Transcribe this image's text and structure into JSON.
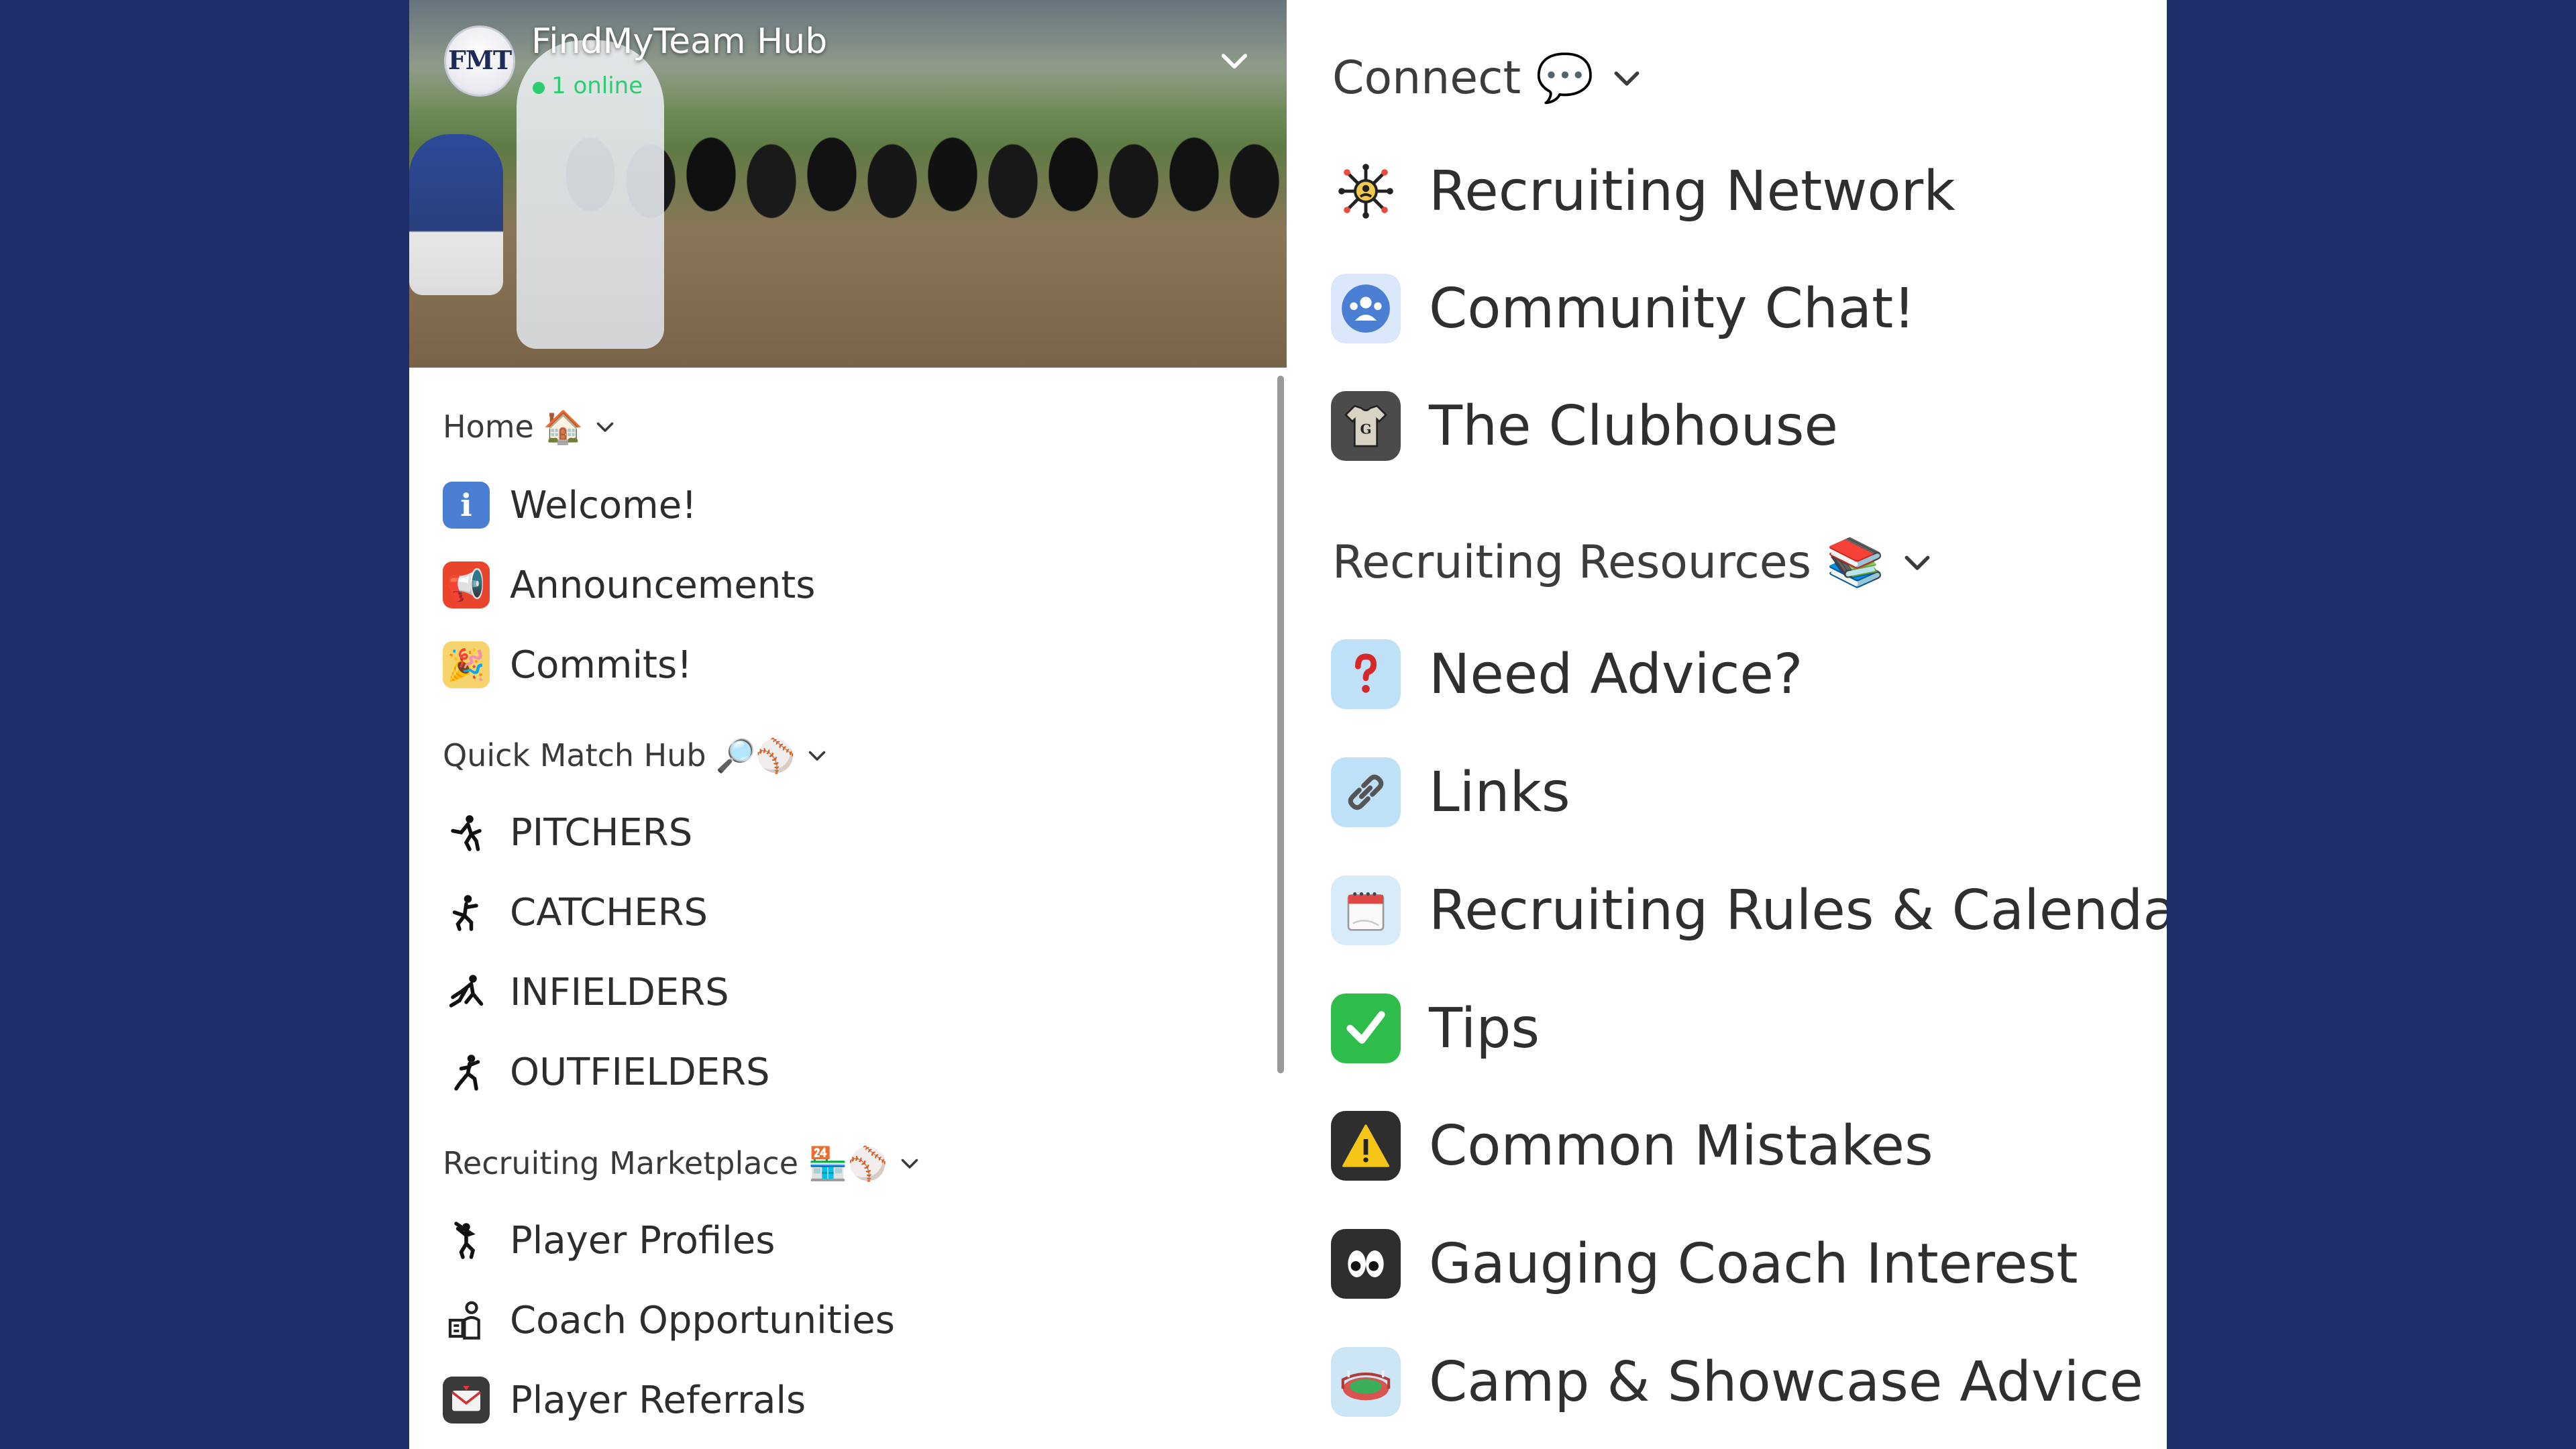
{
  "header": {
    "title": "FindMyTeam Hub",
    "logo_text": "FMT",
    "online_status": "1 online"
  },
  "left": {
    "sections": [
      {
        "label": "Home",
        "emoji": "🏠",
        "items": [
          {
            "label": "Welcome!",
            "icon": "info-icon",
            "glyph": "i",
            "color": "#4a7fd4"
          },
          {
            "label": "Announcements",
            "icon": "megaphone-icon",
            "glyph": "📢",
            "color": "#e8452c"
          },
          {
            "label": "Commits!",
            "icon": "party-popper-icon",
            "glyph": "🎉",
            "color": "#f6d36b"
          }
        ]
      },
      {
        "label": "Quick Match Hub",
        "emoji": "🔎⚾",
        "items": [
          {
            "label": "PITCHERS",
            "icon": "pitcher-icon",
            "glyph": "🤾"
          },
          {
            "label": "CATCHERS",
            "icon": "catcher-icon",
            "glyph": "🏃"
          },
          {
            "label": "INFIELDERS",
            "icon": "infielder-icon",
            "glyph": "🤸"
          },
          {
            "label": "OUTFIELDERS",
            "icon": "outfielder-icon",
            "glyph": "🏃"
          }
        ]
      },
      {
        "label": "Recruiting Marketplace",
        "emoji": "🏪⚾",
        "items": [
          {
            "label": "Player Profiles",
            "icon": "batter-icon",
            "glyph": "🏌"
          },
          {
            "label": "Coach Opportunities",
            "icon": "coach-icon",
            "glyph": "📋"
          },
          {
            "label": "Player Referrals",
            "icon": "envelope-icon",
            "glyph": "📩",
            "color": "#3a3a3a"
          }
        ]
      }
    ]
  },
  "right": {
    "sections": [
      {
        "label": "Connect",
        "emoji": "💬",
        "items": [
          {
            "label": "Recruiting Network",
            "icon": "network-icon",
            "glyph": "🕸"
          },
          {
            "label": "Community Chat!",
            "icon": "people-chat-icon",
            "glyph": "👥",
            "color": "#4a7fd4"
          },
          {
            "label": "The Clubhouse",
            "icon": "jersey-icon",
            "glyph": "👕",
            "color": "#4b4b4b"
          }
        ]
      },
      {
        "label": "Recruiting Resources",
        "emoji": "📚",
        "items": [
          {
            "label": "Need Advice?",
            "icon": "question-icon",
            "glyph": "❓",
            "color": "#bfe1f7"
          },
          {
            "label": "Links",
            "icon": "link-icon",
            "glyph": "🔗",
            "color": "#bfe1f7"
          },
          {
            "label": "Recruiting Rules & Calendar",
            "icon": "calendar-icon",
            "glyph": "🗓",
            "color": "#d7ecf8"
          },
          {
            "label": "Tips",
            "icon": "checkmark-icon",
            "glyph": "✅",
            "color": "#2ebd4a"
          },
          {
            "label": "Common Mistakes",
            "icon": "warning-icon",
            "glyph": "⚠",
            "color": "#2e2e2e"
          },
          {
            "label": "Gauging Coach Interest",
            "icon": "eyes-icon",
            "glyph": "👀",
            "color": "#2e2e2e"
          },
          {
            "label": "Camp & Showcase Advice",
            "icon": "stadium-icon",
            "glyph": "🏟",
            "color": "#cde6f6"
          }
        ]
      }
    ]
  },
  "colors": {
    "background": "#1f2d6b",
    "panel": "#ffffff",
    "online": "#2ecc71",
    "text": "#2d2d2d"
  }
}
